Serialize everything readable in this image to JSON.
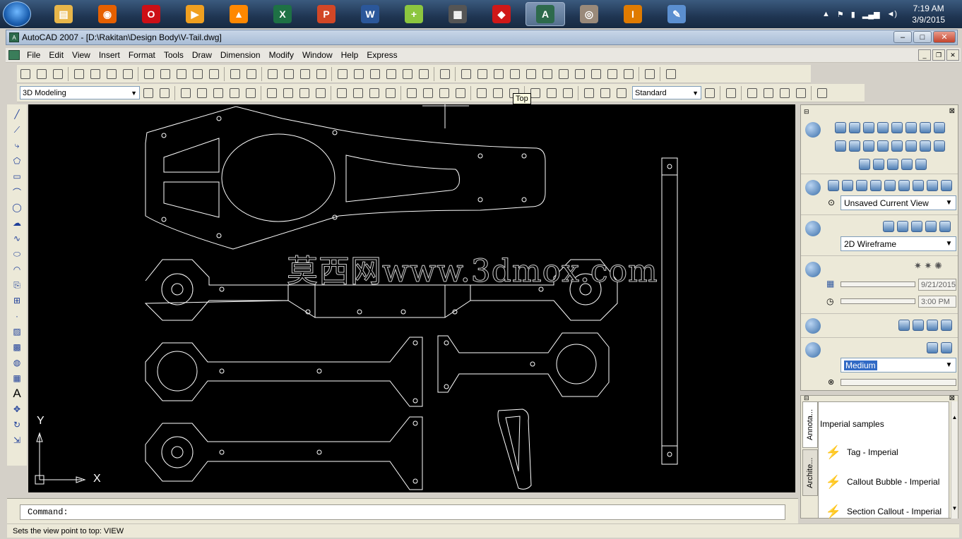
{
  "taskbar": {
    "apps": [
      {
        "name": "file-explorer-icon",
        "color": "#e8b64a",
        "glyph": "▤"
      },
      {
        "name": "firefox-icon",
        "color": "#e66000",
        "glyph": "◉"
      },
      {
        "name": "opera-icon",
        "color": "#cc0f16",
        "glyph": "O"
      },
      {
        "name": "media-player-icon",
        "color": "#f0a020",
        "glyph": "▶"
      },
      {
        "name": "vlc-icon",
        "color": "#ff8800",
        "glyph": "▲"
      },
      {
        "name": "excel-icon",
        "color": "#1e7145",
        "glyph": "X"
      },
      {
        "name": "powerpoint-icon",
        "color": "#d24726",
        "glyph": "P"
      },
      {
        "name": "word-icon",
        "color": "#2b579a",
        "glyph": "W"
      },
      {
        "name": "add-app-icon",
        "color": "#8cc63f",
        "glyph": "+"
      },
      {
        "name": "monitor-app-icon",
        "color": "#555555",
        "glyph": "▦"
      },
      {
        "name": "red-app-icon",
        "color": "#d01818",
        "glyph": "◆"
      },
      {
        "name": "autocad-icon",
        "color": "#2d6a4c",
        "glyph": "A"
      },
      {
        "name": "disc-icon",
        "color": "#9a8a7a",
        "glyph": "◎"
      },
      {
        "name": "app-i-icon",
        "color": "#e07b00",
        "glyph": "I"
      },
      {
        "name": "paint-icon",
        "color": "#5b8fd0",
        "glyph": "✎"
      }
    ],
    "active_index": 11,
    "clock_time": "7:19 AM",
    "clock_date": "3/9/2015"
  },
  "window": {
    "title": "AutoCAD 2007 - [D:\\Rakitan\\Design Body\\V-Tail.dwg]",
    "minimize": "–",
    "maximize": "□",
    "close": "✕"
  },
  "menu": [
    "File",
    "Edit",
    "View",
    "Insert",
    "Format",
    "Tools",
    "Draw",
    "Dimension",
    "Modify",
    "Window",
    "Help",
    "Express"
  ],
  "toolbar": {
    "workspace": "3D Modeling",
    "dimstyle": "Standard",
    "tooltip": "Top"
  },
  "drawing": {
    "watermark": "莫西网www.3dmox.com",
    "ucs_x": "X",
    "ucs_y": "Y"
  },
  "dashboard": {
    "view_combo": "Unsaved Current View",
    "visual_style": "2D Wireframe",
    "date": "9/21/2015",
    "time": "3:00 PM",
    "quality": "Medium"
  },
  "palette": {
    "tabs": [
      "Annota...",
      "Archite..."
    ],
    "header": "Imperial samples",
    "items": [
      "Tag - Imperial",
      "Callout Bubble - Imperial",
      "Section Callout - Imperial"
    ]
  },
  "command": {
    "prompt": "Command:"
  },
  "status": {
    "text": "Sets the view point to top:  VIEW"
  }
}
